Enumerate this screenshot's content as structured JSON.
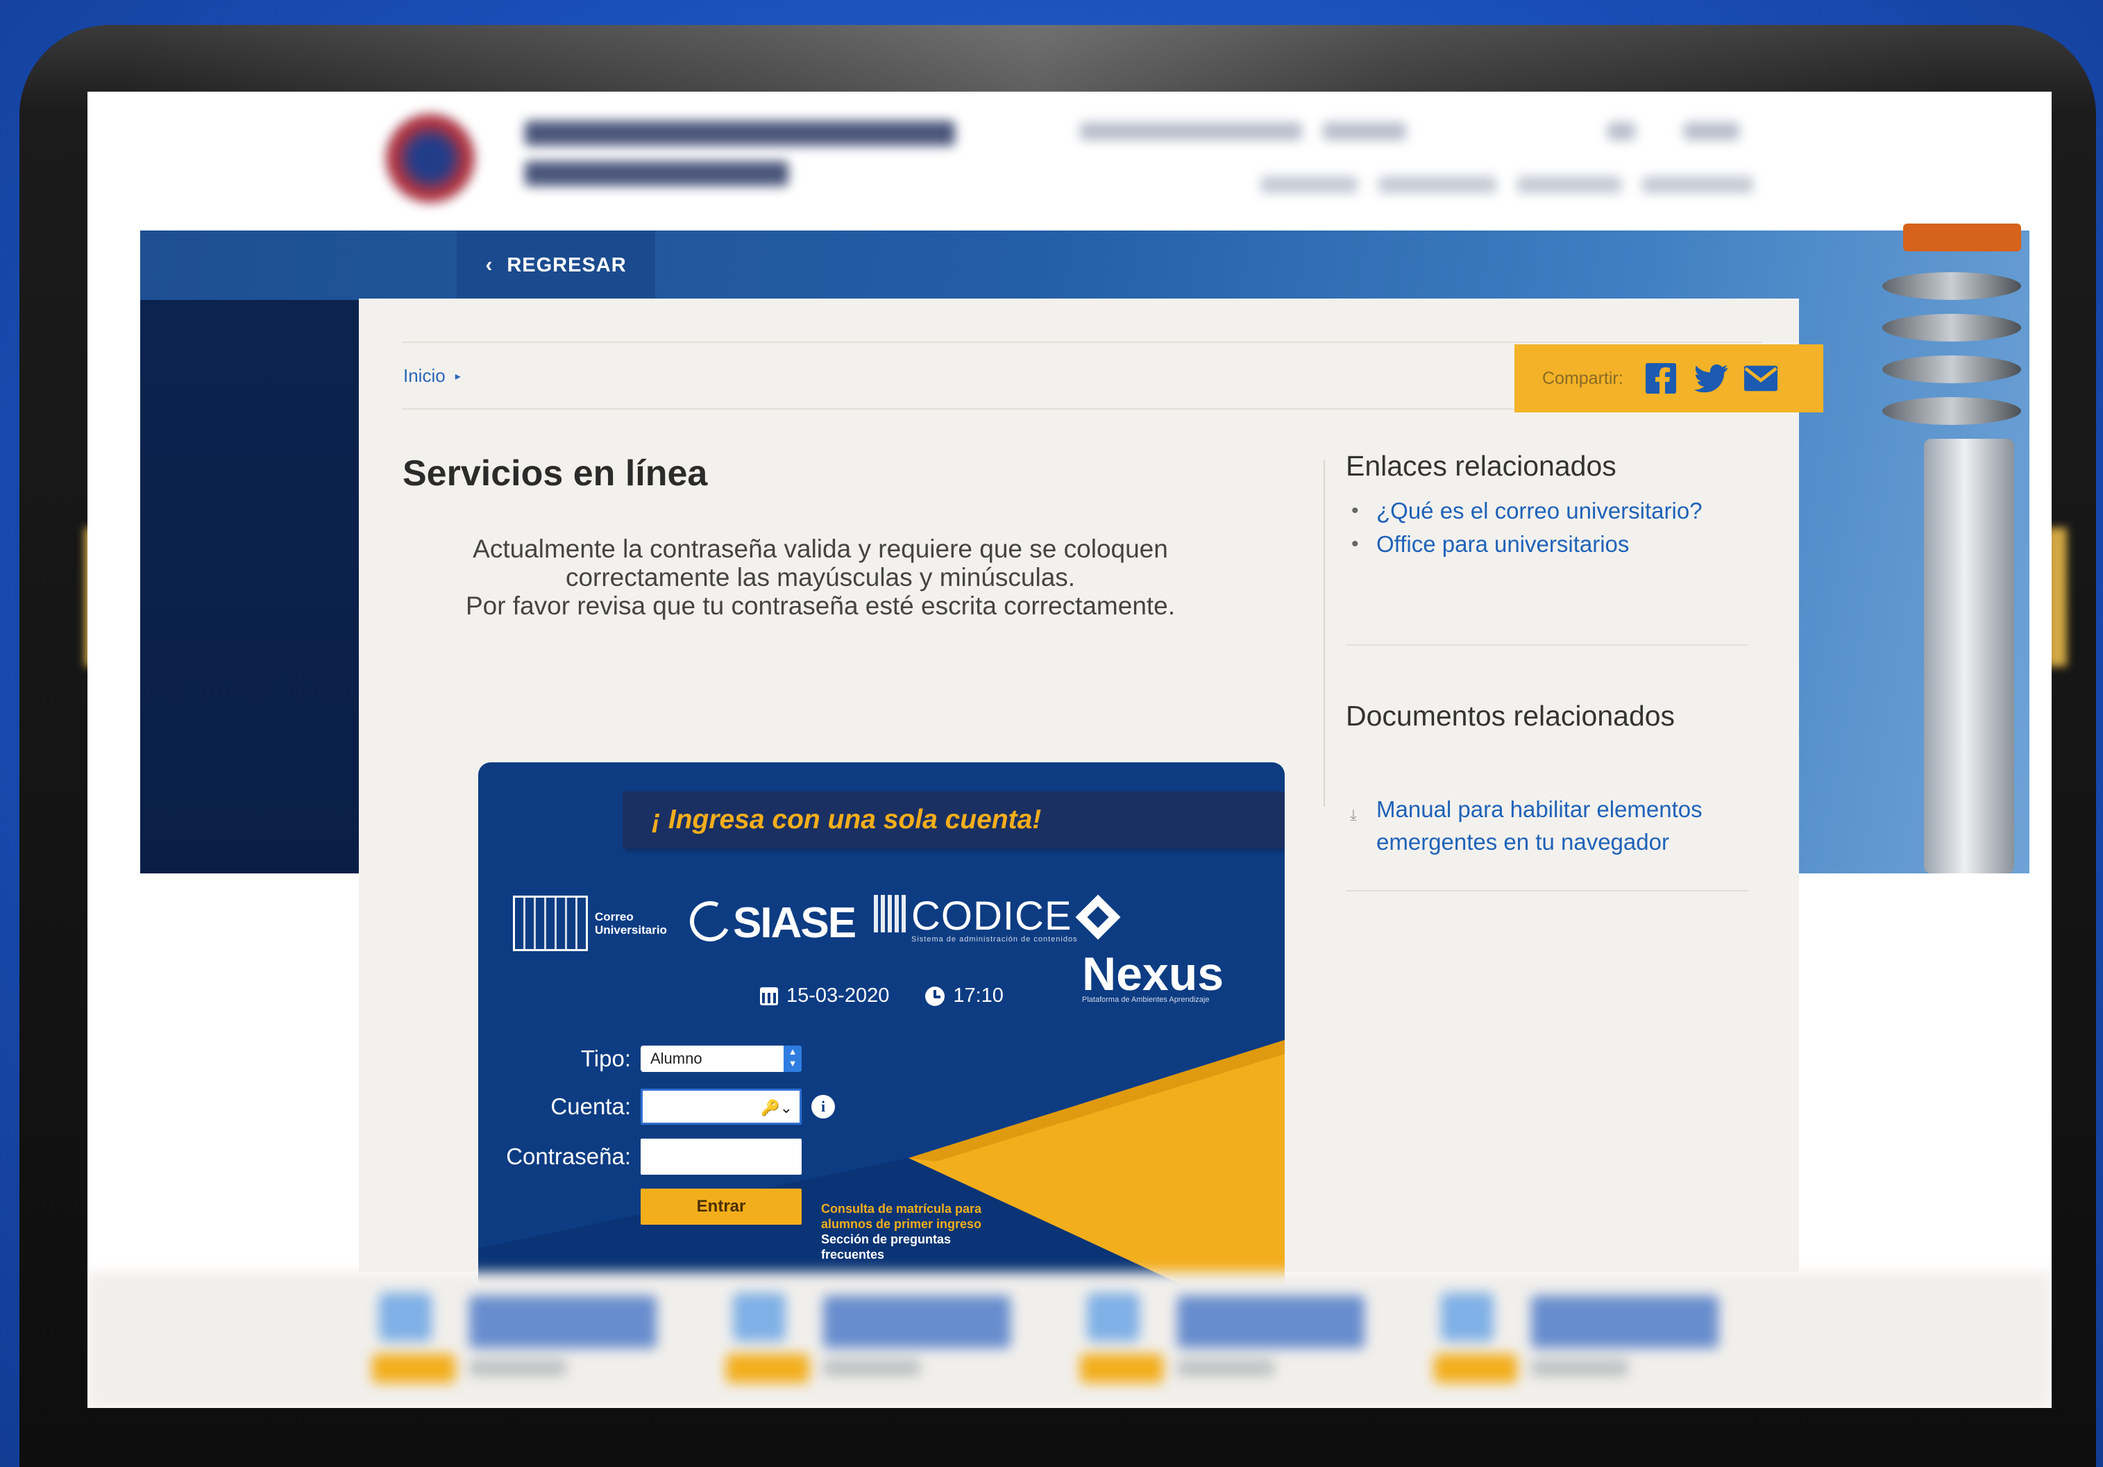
{
  "nav": {
    "back_label": "REGRESAR"
  },
  "breadcrumb": {
    "home": "Inicio"
  },
  "share": {
    "label": "Compartir:",
    "icons": [
      "facebook-icon",
      "twitter-icon",
      "email-icon"
    ]
  },
  "page": {
    "title": "Servicios en línea",
    "notice_line1": "Actualmente la contraseña valida y requiere que se coloquen",
    "notice_line2": "correctamente las mayúsculas y minúsculas.",
    "notice_line3": "Por favor revisa que tu contraseña esté escrita correctamente."
  },
  "login": {
    "banner": "¡ Ingresa con una sola cuenta!",
    "logos": {
      "uanl_line1": "Correo",
      "uanl_line2": "Universitario",
      "siase": "SIASE",
      "codice": "CODICE",
      "codice_sub": "Sistema de administración de contenidos",
      "nexus": "Nexus",
      "nexus_sub": "Plataforma de Ambientes Aprendizaje"
    },
    "date": "15-03-2020",
    "time": "17:10",
    "tipo_label": "Tipo:",
    "tipo_value": "Alumno",
    "cuenta_label": "Cuenta:",
    "password_label": "Contraseña:",
    "submit_label": "Entrar",
    "link_consulta_1": "Consulta de matrícula para",
    "link_consulta_2": "alumnos de primer ingreso",
    "link_faq_1": "Sección de preguntas",
    "link_faq_2": "frecuentes"
  },
  "sidebar": {
    "related_links_title": "Enlaces relacionados",
    "related_links": [
      "¿Qué es el correo universitario?",
      "Office para universitarios"
    ],
    "related_docs_title": "Documentos relacionados",
    "related_docs_line1": "Manual para habilitar elementos",
    "related_docs_line2": "emergentes en tu navegador"
  },
  "colors": {
    "primary_blue": "#0d3c83",
    "accent_yellow": "#f3ae1c",
    "link_blue": "#1f62b8"
  }
}
